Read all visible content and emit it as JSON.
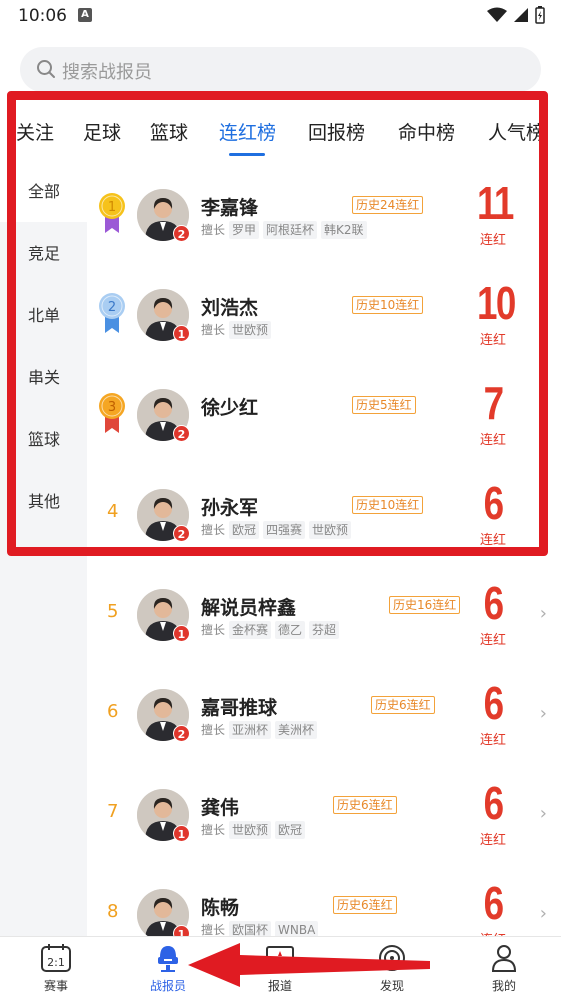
{
  "status": {
    "time": "10:06",
    "a_icon": "A"
  },
  "search": {
    "placeholder": "搜索战报员"
  },
  "tabs": [
    {
      "label": "关注"
    },
    {
      "label": "足球"
    },
    {
      "label": "篮球"
    },
    {
      "label": "连红榜"
    },
    {
      "label": "回报榜"
    },
    {
      "label": "命中榜"
    },
    {
      "label": "人气榜"
    }
  ],
  "categories": [
    "全部",
    "竞足",
    "北单",
    "串关",
    "篮球",
    "其他"
  ],
  "rows": [
    {
      "rank": "1",
      "name": "李嘉锋",
      "history": "历史24连红",
      "tag_label": "擅长",
      "tags": [
        "罗甲",
        "阿根廷杯",
        "韩K2联"
      ],
      "streak": "11",
      "streak_label": "连红",
      "badge": "2"
    },
    {
      "rank": "2",
      "name": "刘浩杰",
      "history": "历史10连红",
      "tag_label": "擅长",
      "tags": [
        "世欧预"
      ],
      "streak": "10",
      "streak_label": "连红",
      "badge": "1"
    },
    {
      "rank": "3",
      "name": "徐少红",
      "history": "历史5连红",
      "tag_label": "",
      "tags": [],
      "streak": "7",
      "streak_label": "连红",
      "badge": "2"
    },
    {
      "rank": "4",
      "name": "孙永军",
      "history": "历史10连红",
      "tag_label": "擅长",
      "tags": [
        "欧冠",
        "四强赛",
        "世欧预"
      ],
      "streak": "6",
      "streak_label": "连红",
      "badge": "2"
    },
    {
      "rank": "5",
      "name": "解说员梓鑫",
      "history": "历史16连红",
      "tag_label": "擅长",
      "tags": [
        "金杯赛",
        "德乙",
        "芬超"
      ],
      "streak": "6",
      "streak_label": "连红",
      "badge": "1"
    },
    {
      "rank": "6",
      "name": "嘉哥推球",
      "history": "历史6连红",
      "tag_label": "擅长",
      "tags": [
        "亚洲杯",
        "美洲杯"
      ],
      "streak": "6",
      "streak_label": "连红",
      "badge": "2"
    },
    {
      "rank": "7",
      "name": "龚伟",
      "history": "历史6连红",
      "tag_label": "擅长",
      "tags": [
        "世欧预",
        "欧冠"
      ],
      "streak": "6",
      "streak_label": "连红",
      "badge": "1"
    },
    {
      "rank": "8",
      "name": "陈畅",
      "history": "历史6连红",
      "tag_label": "擅长",
      "tags": [
        "欧国杯",
        "WNBA"
      ],
      "streak": "6",
      "streak_label": "连红",
      "badge": "1"
    }
  ],
  "bottom_nav": [
    {
      "label": "赛事",
      "icon": "calendar-score-icon"
    },
    {
      "label": "战报员",
      "icon": "microphone-icon"
    },
    {
      "label": "报道",
      "icon": "monitor-icon"
    },
    {
      "label": "发现",
      "icon": "discover-icon"
    },
    {
      "label": "我的",
      "icon": "profile-icon"
    }
  ],
  "colors": {
    "accent": "#1f6fe0",
    "streak": "#e23a2a",
    "rank": "#f0a020",
    "annotation": "#e01b22"
  }
}
